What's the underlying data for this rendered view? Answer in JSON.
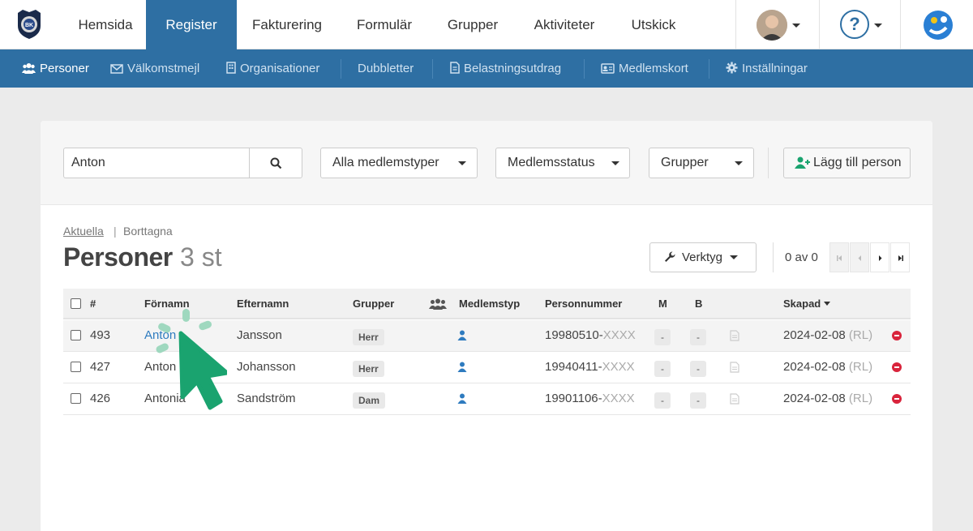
{
  "topnav": {
    "logo_icon": "club-logo-icon",
    "tabs": [
      {
        "label": "Hemsida",
        "active": false
      },
      {
        "label": "Register",
        "active": true
      },
      {
        "label": "Fakturering",
        "active": false
      },
      {
        "label": "Formulär",
        "active": false
      },
      {
        "label": "Grupper",
        "active": false
      },
      {
        "label": "Aktiviteter",
        "active": false
      },
      {
        "label": "Utskick",
        "active": false
      }
    ],
    "help_label": "?"
  },
  "subnav": {
    "items": [
      {
        "label": "Personer",
        "icon": "users-icon",
        "active": true
      },
      {
        "label": "Välkomstmejl",
        "icon": "envelope-icon",
        "active": false
      },
      {
        "label": "Organisationer",
        "icon": "building-icon",
        "active": false
      },
      {
        "label": "Dubbletter",
        "icon": "",
        "active": false
      },
      {
        "label": "Belastningsutdrag",
        "icon": "document-icon",
        "active": false
      },
      {
        "label": "Medlemskort",
        "icon": "id-card-icon",
        "active": false
      },
      {
        "label": "Inställningar",
        "icon": "gear-icon",
        "active": false
      }
    ]
  },
  "filters": {
    "search_value": "Anton",
    "membership_types": "Alla medlemstyper",
    "membership_status": "Medlemsstatus",
    "groups": "Grupper",
    "add_person": "Lägg till person"
  },
  "views": {
    "current": "Aktuella",
    "separator": "|",
    "deleted": "Borttagna"
  },
  "title": {
    "text": "Personer",
    "count": "3 st"
  },
  "tools": {
    "label": "Verktyg"
  },
  "pager": {
    "text": "0 av 0"
  },
  "table": {
    "headers": {
      "number": "#",
      "first_name": "Förnamn",
      "last_name": "Efternamn",
      "groups": "Grupper",
      "member_type": "Medlemstyp",
      "personal_number": "Personnummer",
      "m": "M",
      "b": "B",
      "created": "Skapad"
    },
    "rows": [
      {
        "id": "493",
        "first_name": "Anton",
        "last_name": "Jansson",
        "group": "Herr",
        "pnr": "19980510-",
        "pnr_mask": "XXXX",
        "m": "-",
        "b": "-",
        "created": "2024-02-08",
        "created_by": "(RL)"
      },
      {
        "id": "427",
        "first_name": "Anton",
        "last_name": "Johansson",
        "group": "Herr",
        "pnr": "19940411-",
        "pnr_mask": "XXXX",
        "m": "-",
        "b": "-",
        "created": "2024-02-08",
        "created_by": "(RL)"
      },
      {
        "id": "426",
        "first_name": "Antonia",
        "last_name": "Sandström",
        "group": "Dam",
        "pnr": "19901106-",
        "pnr_mask": "XXXX",
        "m": "-",
        "b": "-",
        "created": "2024-02-08",
        "created_by": "(RL)"
      }
    ]
  },
  "colors": {
    "primary": "#2e6fa3",
    "link": "#2e7bbf",
    "danger": "#d9243c",
    "cursor": "#1aa36f"
  }
}
